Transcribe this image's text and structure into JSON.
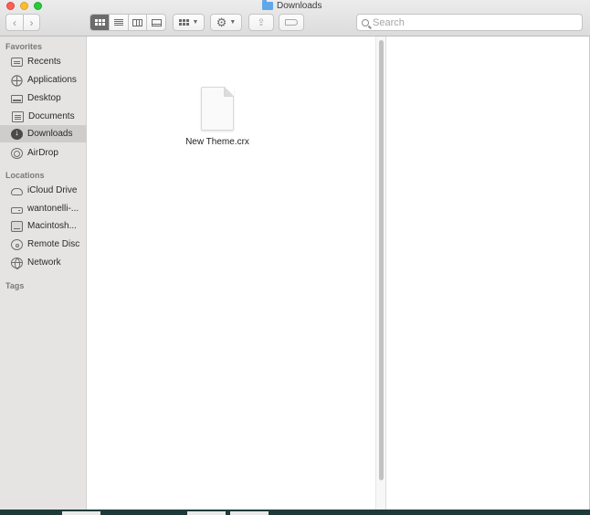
{
  "window": {
    "title": "Downloads"
  },
  "toolbar": {
    "back": "‹",
    "forward": "›",
    "search_placeholder": "Search"
  },
  "sidebar": {
    "favorites_header": "Favorites",
    "locations_header": "Locations",
    "tags_header": "Tags",
    "favorites": [
      {
        "label": "Recents",
        "icon": "recents-icon"
      },
      {
        "label": "Applications",
        "icon": "applications-icon"
      },
      {
        "label": "Desktop",
        "icon": "desktop-icon"
      },
      {
        "label": "Documents",
        "icon": "documents-icon"
      },
      {
        "label": "Downloads",
        "icon": "downloads-icon",
        "selected": true
      },
      {
        "label": "AirDrop",
        "icon": "airdrop-icon"
      }
    ],
    "locations": [
      {
        "label": "iCloud Drive",
        "icon": "icloud-icon"
      },
      {
        "label": "wantonelli-...",
        "icon": "external-drive-icon"
      },
      {
        "label": "Macintosh...",
        "icon": "hard-drive-icon"
      },
      {
        "label": "Remote Disc",
        "icon": "disc-icon"
      },
      {
        "label": "Network",
        "icon": "network-globe-icon"
      }
    ]
  },
  "files": [
    {
      "name": "New Theme.crx",
      "icon": "document-icon"
    }
  ]
}
